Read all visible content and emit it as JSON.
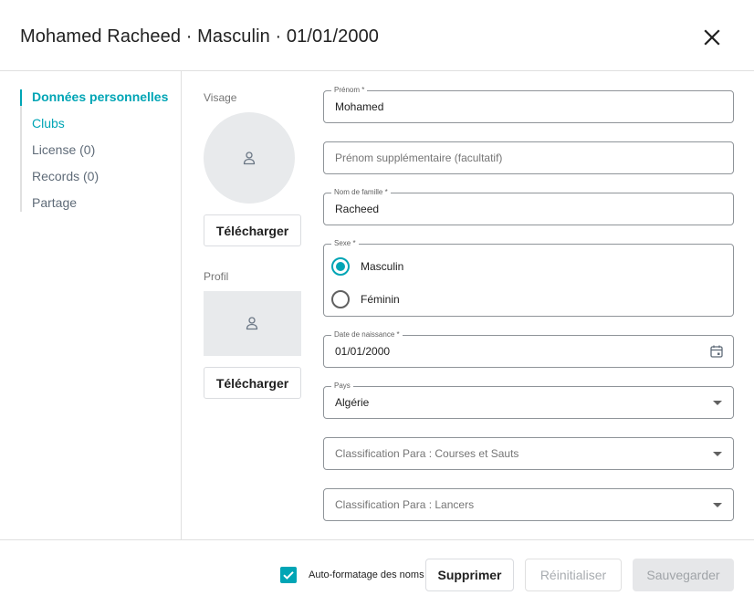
{
  "header": {
    "title": "Mohamed Racheed · Masculin · 01/01/2000",
    "close_icon": "close-icon"
  },
  "nav": {
    "items": [
      {
        "label": "Données personnelles",
        "state": "active"
      },
      {
        "label": "Clubs",
        "state": "link"
      },
      {
        "label": "License (0)",
        "state": "default"
      },
      {
        "label": "Records (0)",
        "state": "default"
      },
      {
        "label": "Partage",
        "state": "default"
      }
    ]
  },
  "photos": {
    "face_label": "Visage",
    "profile_label": "Profil",
    "upload_label": "Télécharger",
    "placeholder_icon": "person-icon"
  },
  "form": {
    "first_name": {
      "label": "Prénom *",
      "value": "Mohamed"
    },
    "extra_first_name": {
      "placeholder": "Prénom supplémentaire (facultatif)"
    },
    "last_name": {
      "label": "Nom de famille *",
      "value": "Racheed"
    },
    "sex": {
      "label": "Sexe *",
      "options": [
        {
          "label": "Masculin",
          "checked": true
        },
        {
          "label": "Féminin",
          "checked": false
        }
      ]
    },
    "birth_date": {
      "label": "Date de naissance *",
      "value": "01/01/2000",
      "icon": "calendar-icon"
    },
    "country": {
      "label": "Pays",
      "value": "Algérie"
    },
    "para_running": {
      "placeholder": "Classification Para : Courses et Sauts"
    },
    "para_throws": {
      "placeholder": "Classification Para : Lancers"
    }
  },
  "footer": {
    "autoformat_label": "Auto-formatage des noms",
    "autoformat_checked": true,
    "delete_label": "Supprimer",
    "reset_label": "Réinitialiser",
    "save_label": "Sauvegarder"
  },
  "colors": {
    "accent": "#00a5b5",
    "text": "#212121",
    "muted": "#5f6b78",
    "border": "#8f9499",
    "disabled_bg": "#e6e7e9"
  }
}
